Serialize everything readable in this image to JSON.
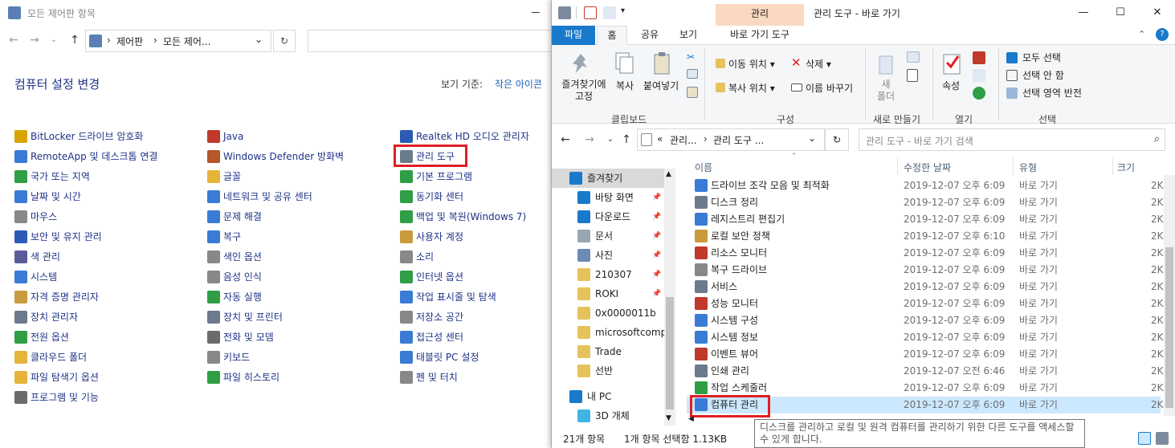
{
  "control_panel": {
    "title": "모든 제어판 항목",
    "breadcrumb": [
      "제어판",
      "모든 제어..."
    ],
    "heading": "컴퓨터 설정 변경",
    "view_by_label": "보기 기준:",
    "view_by_value": "작은 아이콘",
    "columns": [
      [
        {
          "label": "BitLocker 드라이브 암호화",
          "color": "#d9a400"
        },
        {
          "label": "RemoteApp 및 데스크톱 연결",
          "color": "#3a7bd5"
        },
        {
          "label": "국가 또는 지역",
          "color": "#2f9e44"
        },
        {
          "label": "날짜 및 시간",
          "color": "#3a7bd5"
        },
        {
          "label": "마우스",
          "color": "#888888"
        },
        {
          "label": "보안 및 유지 관리",
          "color": "#2b5bb5"
        },
        {
          "label": "색 관리",
          "color": "#5b5b9b"
        },
        {
          "label": "시스템",
          "color": "#3a7bd5"
        },
        {
          "label": "자격 증명 관리자",
          "color": "#c89b3c"
        },
        {
          "label": "장치 관리자",
          "color": "#6b7b8b"
        },
        {
          "label": "전원 옵션",
          "color": "#2f9e44"
        },
        {
          "label": "클라우드 폴더",
          "color": "#e6b43a"
        },
        {
          "label": "파일 탐색기 옵션",
          "color": "#e6b43a"
        },
        {
          "label": "프로그램 및 기능",
          "color": "#6b6b6b"
        }
      ],
      [
        {
          "label": "Java",
          "color": "#c0392b"
        },
        {
          "label": "Windows Defender 방화벽",
          "color": "#b5562b"
        },
        {
          "label": "글꼴",
          "color": "#e6b43a"
        },
        {
          "label": "네트워크 및 공유 센터",
          "color": "#3a7bd5"
        },
        {
          "label": "문제 해결",
          "color": "#3a7bd5"
        },
        {
          "label": "복구",
          "color": "#3a7bd5"
        },
        {
          "label": "색인 옵션",
          "color": "#888888"
        },
        {
          "label": "음성 인식",
          "color": "#888888"
        },
        {
          "label": "자동 실행",
          "color": "#2f9e44"
        },
        {
          "label": "장치 및 프린터",
          "color": "#6b7b8b"
        },
        {
          "label": "전화 및 모뎀",
          "color": "#6b6b6b"
        },
        {
          "label": "키보드",
          "color": "#888888"
        },
        {
          "label": "파일 히스토리",
          "color": "#2f9e44"
        }
      ],
      [
        {
          "label": "Realtek HD 오디오 관리자",
          "color": "#2b5bb5"
        },
        {
          "label": "관리 도구",
          "color": "#6b7b8b"
        },
        {
          "label": "기본 프로그램",
          "color": "#2f9e44"
        },
        {
          "label": "동기화 센터",
          "color": "#2f9e44"
        },
        {
          "label": "백업 및 복원(Windows 7)",
          "color": "#2f9e44"
        },
        {
          "label": "사용자 계정",
          "color": "#c89b3c"
        },
        {
          "label": "소리",
          "color": "#888888"
        },
        {
          "label": "인터넷 옵션",
          "color": "#2f9e44"
        },
        {
          "label": "작업 표시줄 및 탐색",
          "color": "#3a7bd5"
        },
        {
          "label": "저장소 공간",
          "color": "#888888"
        },
        {
          "label": "접근성 센터",
          "color": "#3a7bd5"
        },
        {
          "label": "태블릿 PC 설정",
          "color": "#3a7bd5"
        },
        {
          "label": "펜 및 터치",
          "color": "#888888"
        }
      ]
    ]
  },
  "explorer": {
    "context_group": "관리",
    "title": "관리 도구 - 바로 가기",
    "ribbon_tabs": [
      "파일",
      "홈",
      "공유",
      "보기",
      "바로 가기 도구"
    ],
    "ribbon": {
      "pin": "즐겨찾기에\n고정",
      "copy": "복사",
      "paste": "붙여넣기",
      "clipboard_group": "클립보드",
      "move_to": "이동 위치",
      "copy_to": "복사 위치",
      "delete": "삭제",
      "rename": "이름 바꾸기",
      "organize_group": "구성",
      "new_folder": "새\n폴더",
      "new_group": "새로 만들기",
      "properties": "속성",
      "open_group": "열기",
      "select_all": "모두 선택",
      "select_none": "선택 안 함",
      "invert_selection": "선택 영역 반전",
      "select_group": "선택"
    },
    "breadcrumb": [
      "«",
      "관리...",
      "관리 도구 ..."
    ],
    "search_placeholder": "관리 도구 - 바로 가기 검색",
    "nav": [
      {
        "label": "즐겨찾기",
        "icon": "star-icon",
        "color": "#1979ca",
        "pinned": false,
        "selected": true
      },
      {
        "label": "바탕 화면",
        "icon": "desktop-icon",
        "color": "#1979ca",
        "pinned": true
      },
      {
        "label": "다운로드",
        "icon": "download-icon",
        "color": "#1979ca",
        "pinned": true
      },
      {
        "label": "문서",
        "icon": "document-icon",
        "color": "#9aa6b2",
        "pinned": true
      },
      {
        "label": "사진",
        "icon": "pictures-icon",
        "color": "#6b8bb5",
        "pinned": true
      },
      {
        "label": "210307",
        "icon": "folder-icon",
        "color": "#e6c25a",
        "pinned": true
      },
      {
        "label": "ROKI",
        "icon": "folder-icon",
        "color": "#e6c25a",
        "pinned": true
      },
      {
        "label": "0x0000011b",
        "icon": "folder-icon",
        "color": "#e6c25a",
        "pinned": false
      },
      {
        "label": "microsoftcompa",
        "icon": "folder-icon",
        "color": "#e6c25a",
        "pinned": false
      },
      {
        "label": "Trade",
        "icon": "folder-icon",
        "color": "#e6c25a",
        "pinned": false
      },
      {
        "label": "선반",
        "icon": "folder-icon",
        "color": "#e6c25a",
        "pinned": false
      },
      {
        "label": "내 PC",
        "icon": "pc-icon",
        "color": "#1979ca",
        "pinned": false
      },
      {
        "label": "3D 개체",
        "icon": "cube-icon",
        "color": "#3fb5e6",
        "pinned": false
      }
    ],
    "columns": {
      "name": "이름",
      "date": "수정한 날짜",
      "type": "유형",
      "size": "크기"
    },
    "files": [
      {
        "name": "드라이브 조각 모음 및 최적화",
        "date": "2019-12-07 오후 6:09",
        "type": "바로 가기",
        "size": "2K",
        "color": "#3a7bd5"
      },
      {
        "name": "디스크 정리",
        "date": "2019-12-07 오후 6:09",
        "type": "바로 가기",
        "size": "2K",
        "color": "#6b7b8b"
      },
      {
        "name": "레지스트리 편집기",
        "date": "2019-12-07 오후 6:09",
        "type": "바로 가기",
        "size": "2K",
        "color": "#3a7bd5"
      },
      {
        "name": "로컬 보안 정책",
        "date": "2019-12-07 오후 6:10",
        "type": "바로 가기",
        "size": "2K",
        "color": "#c89b3c"
      },
      {
        "name": "리소스 모니터",
        "date": "2019-12-07 오후 6:09",
        "type": "바로 가기",
        "size": "2K",
        "color": "#c0392b"
      },
      {
        "name": "복구 드라이브",
        "date": "2019-12-07 오후 6:09",
        "type": "바로 가기",
        "size": "2K",
        "color": "#888888"
      },
      {
        "name": "서비스",
        "date": "2019-12-07 오후 6:09",
        "type": "바로 가기",
        "size": "2K",
        "color": "#6b7b8b"
      },
      {
        "name": "성능 모니터",
        "date": "2019-12-07 오후 6:09",
        "type": "바로 가기",
        "size": "2K",
        "color": "#c0392b"
      },
      {
        "name": "시스템 구성",
        "date": "2019-12-07 오후 6:09",
        "type": "바로 가기",
        "size": "2K",
        "color": "#3a7bd5"
      },
      {
        "name": "시스템 정보",
        "date": "2019-12-07 오후 6:09",
        "type": "바로 가기",
        "size": "2K",
        "color": "#3a7bd5"
      },
      {
        "name": "이벤트 뷰어",
        "date": "2019-12-07 오후 6:09",
        "type": "바로 가기",
        "size": "2K",
        "color": "#c0392b"
      },
      {
        "name": "인쇄 관리",
        "date": "2019-12-07 오전 6:46",
        "type": "바로 가기",
        "size": "2K",
        "color": "#6b7b8b"
      },
      {
        "name": "작업 스케줄러",
        "date": "2019-12-07 오후 6:09",
        "type": "바로 가기",
        "size": "2K",
        "color": "#2f9e44"
      },
      {
        "name": "컴퓨터 관리",
        "date": "2019-12-07 오후 6:09",
        "type": "바로 가기",
        "size": "2K",
        "color": "#3a7bd5",
        "selected": true
      }
    ],
    "status": {
      "count": "21개 항목",
      "selection": "1개 항목 선택함 1.13KB"
    },
    "tooltip": "디스크를 관리하고 로컬 및 원격 컴퓨터를 관리하기 위한 다른 도구를 액세스할 수 있게 합니다."
  }
}
